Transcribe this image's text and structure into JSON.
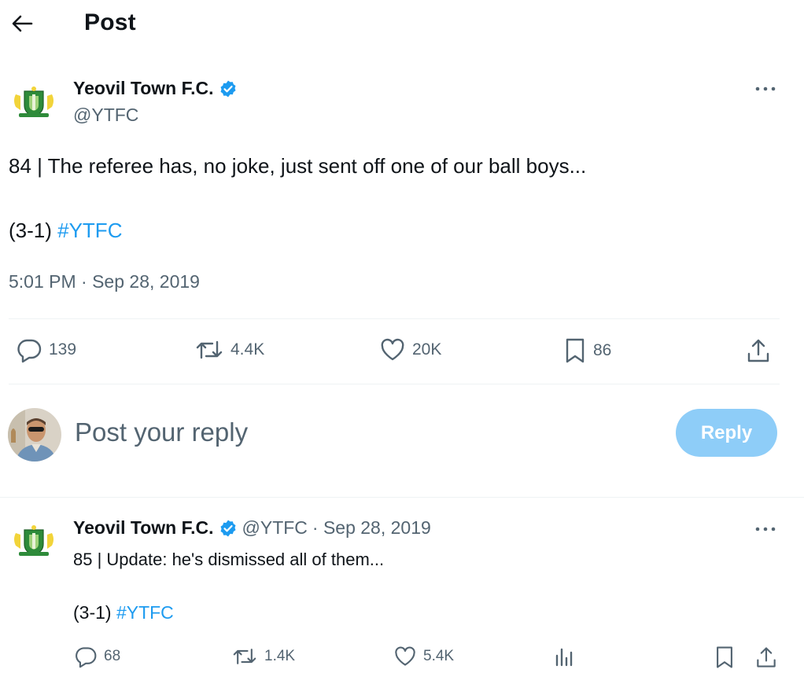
{
  "header": {
    "title": "Post",
    "back_icon": "arrow-left-icon"
  },
  "main_post": {
    "name": "Yeovil Town F.C.",
    "handle": "@YTFC",
    "text_line1": "84 | The referee has, no joke, just sent off one of our ball boys...",
    "text_line2_prefix": "(3-1) ",
    "hashtag": "#YTFC",
    "timestamp": "5:01 PM · Sep 28, 2019",
    "stats": {
      "replies": "139",
      "reposts": "4.4K",
      "likes": "20K",
      "bookmarks": "86"
    }
  },
  "composer": {
    "placeholder": "Post your reply",
    "button_label": "Reply"
  },
  "reply_post": {
    "name": "Yeovil Town F.C.",
    "handle": "@YTFC",
    "date": "· Sep 28, 2019",
    "text_line1": "85 | Update: he's dismissed all of them...",
    "text_line2_prefix": "(3-1) ",
    "hashtag": "#YTFC",
    "stats": {
      "replies": "68",
      "reposts": "1.4K",
      "likes": "5.4K"
    }
  },
  "colors": {
    "accent": "#1d9bf0",
    "reply_button": "#8ecdf8",
    "text_secondary": "#536471",
    "text_primary": "#0f1419"
  }
}
